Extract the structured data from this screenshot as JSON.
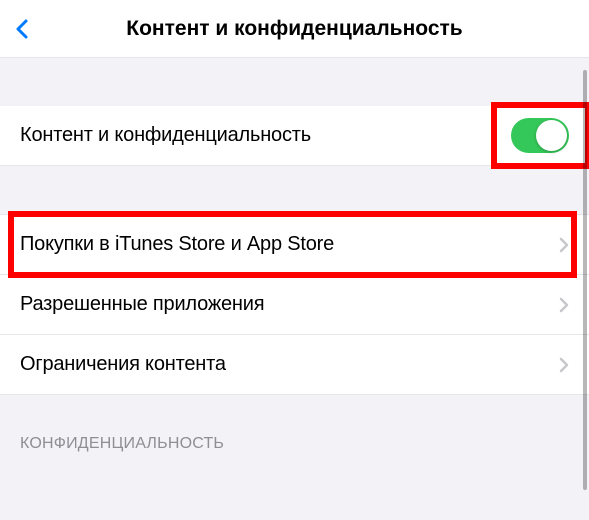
{
  "header": {
    "title": "Контент и конфиденциальность"
  },
  "toggle_row": {
    "label": "Контент и конфиденциальность",
    "enabled": true
  },
  "purchase_row": {
    "label": "Покупки в iTunes Store и App Store"
  },
  "allowed_apps_row": {
    "label": "Разрешенные приложения"
  },
  "content_restrictions_row": {
    "label": "Ограничения контента"
  },
  "footer": {
    "section_title": "КОНФИДЕНЦИАЛЬНОСТЬ"
  },
  "highlight_color": "#ff0000",
  "toggle_on_color": "#34c759"
}
